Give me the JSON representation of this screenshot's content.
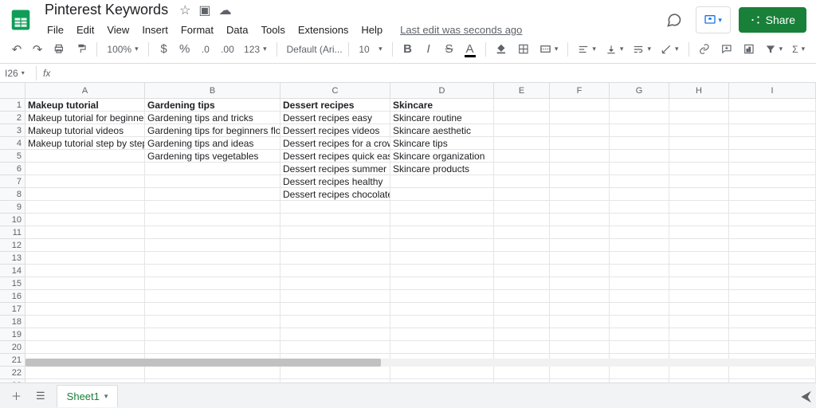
{
  "doc_title": "Pinterest Keywords",
  "menus": [
    "File",
    "Edit",
    "View",
    "Insert",
    "Format",
    "Data",
    "Tools",
    "Extensions",
    "Help"
  ],
  "last_edit": "Last edit was seconds ago",
  "share_label": "Share",
  "zoom": "100%",
  "font_name": "Default (Ari...",
  "font_size": "10",
  "name_box": "I26",
  "columns": [
    "A",
    "B",
    "C",
    "D",
    "E",
    "F",
    "G",
    "H",
    "I"
  ],
  "row_count": 23,
  "sheet_tab": "Sheet1",
  "chart_data": {
    "type": "table",
    "headers": [
      "Makeup tutorial",
      "Gardening tips",
      "Dessert recipes",
      "Skincare"
    ],
    "columns": {
      "A": [
        "Makeup tutorial for beginners",
        "Makeup tutorial videos",
        "Makeup tutorial step by step"
      ],
      "B": [
        "Gardening tips and tricks",
        "Gardening tips for beginners flower",
        "Gardening tips and ideas",
        "Gardening tips vegetables"
      ],
      "C": [
        "Dessert recipes easy",
        "Dessert recipes videos",
        "Dessert recipes for a crowd",
        "Dessert recipes quick easy",
        "Dessert recipes summer",
        "Dessert recipes healthy",
        "Dessert recipes chocolate"
      ],
      "D": [
        "Skincare routine",
        "Skincare aesthetic",
        "Skincare tips",
        "Skincare organization",
        "Skincare products"
      ]
    }
  }
}
